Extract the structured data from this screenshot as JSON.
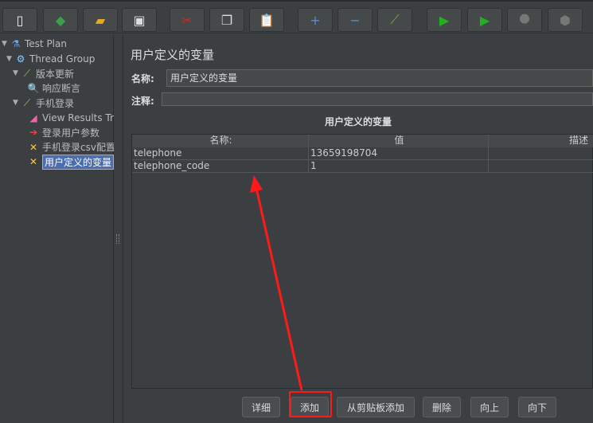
{
  "toolbar": [
    {
      "name": "new-icon",
      "glyph": "▯",
      "color": "#f0f0f0"
    },
    {
      "name": "templates-icon",
      "glyph": "◆",
      "color": "#3aa04a"
    },
    {
      "name": "open-icon",
      "glyph": "▰",
      "color": "#e8a820"
    },
    {
      "name": "save-icon",
      "glyph": "▣",
      "color": "#dddddd"
    },
    {
      "name": "cut-icon",
      "glyph": "✂",
      "color": "#e02020"
    },
    {
      "name": "copy-icon",
      "glyph": "❐",
      "color": "#dddddd"
    },
    {
      "name": "paste-icon",
      "glyph": "📋",
      "color": "#c08040"
    },
    {
      "name": "expand-icon",
      "glyph": "+",
      "color": "#4a90e0"
    },
    {
      "name": "collapse-icon",
      "glyph": "−",
      "color": "#4a90e0"
    },
    {
      "name": "toggle-icon",
      "glyph": "⟋",
      "color": "#7ab040"
    },
    {
      "name": "start-icon",
      "glyph": "▶",
      "color": "#20b020"
    },
    {
      "name": "start-no-timers-icon",
      "glyph": "▶",
      "color": "#20b020"
    },
    {
      "name": "stop-icon",
      "glyph": "⯃",
      "color": "#777777"
    },
    {
      "name": "shutdown-icon",
      "glyph": "⬢",
      "color": "#777777"
    }
  ],
  "tree": [
    {
      "label": "Test Plan",
      "icon": "flask-icon",
      "glyph": "⚗",
      "level": 0,
      "toggle": "▼"
    },
    {
      "label": "Thread Group",
      "icon": "gear-icon",
      "glyph": "⚙",
      "level": 1,
      "toggle": "▼"
    },
    {
      "label": "版本更新",
      "icon": "sampler-icon",
      "glyph": "⟋",
      "level": 2,
      "toggle": "▼"
    },
    {
      "label": "响应断言",
      "icon": "assertion-icon",
      "glyph": "🔍",
      "level": 3,
      "toggle": ""
    },
    {
      "label": "手机登录",
      "icon": "sampler-icon",
      "glyph": "⟋",
      "level": 2,
      "toggle": "▼"
    },
    {
      "label": "View Results Tr",
      "icon": "listener-icon",
      "glyph": "◢",
      "level": 3,
      "toggle": ""
    },
    {
      "label": "登录用户参数",
      "icon": "preprocessor-icon",
      "glyph": "➔",
      "level": 3,
      "toggle": ""
    },
    {
      "label": "手机登录csv配置",
      "icon": "config-icon",
      "glyph": "✕",
      "level": 3,
      "toggle": ""
    },
    {
      "label": "用户定义的变量",
      "icon": "config-icon",
      "glyph": "✕",
      "level": 3,
      "toggle": "",
      "selected": true
    }
  ],
  "main": {
    "title": "用户定义的变量",
    "name_label": "名称:",
    "name_value": "用户定义的变量",
    "comment_label": "注释:",
    "comment_value": "",
    "section_title": "用户定义的变量",
    "columns": [
      "名称:",
      "值",
      "描述"
    ],
    "rows": [
      [
        "telephone",
        "13659198704",
        ""
      ],
      [
        "telephone_code",
        "1",
        ""
      ]
    ]
  },
  "buttons": [
    "详细",
    "添加",
    "从剪贴板添加",
    "删除",
    "向上",
    "向下"
  ],
  "annotation_color": "#ff1a1a"
}
